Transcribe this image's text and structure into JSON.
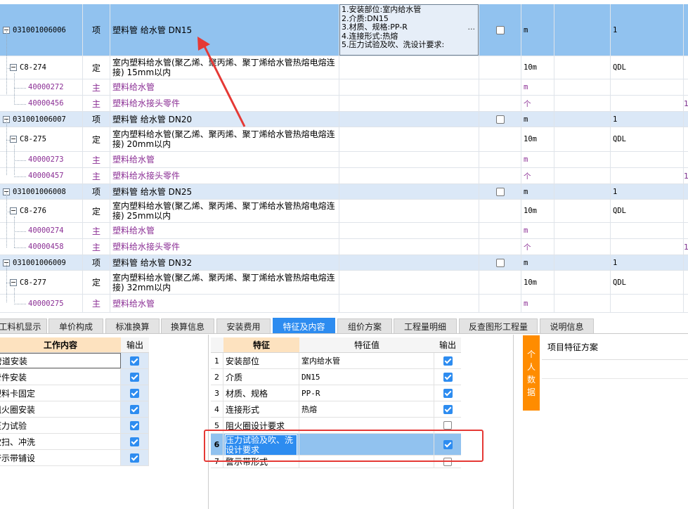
{
  "grid": {
    "rows": [
      {
        "code": "031001006006",
        "type": "项",
        "name": "塑料管 给水管 DN15",
        "unit": "m",
        "qty": "1",
        "selected": true,
        "kind": "item",
        "features": [
          "1.安装部位:室内给水管",
          "2.介质:DN15",
          "3.材质、规格:PP-R",
          "4.连接形式:热熔",
          "5.压力试验及吹、洗设计要求:"
        ]
      },
      {
        "code": "C8-274",
        "type": "定",
        "name": "室内塑料给水管(聚乙烯、聚丙烯、聚丁烯给水管热熔电熔连接) 15mm以内",
        "unit": "10m",
        "qty": "",
        "exp": "QDL",
        "kind": "ding"
      },
      {
        "code": "40000272",
        "type": "主",
        "name": "塑料给水管",
        "unit": "m",
        "kind": "zhu"
      },
      {
        "code": "40000456",
        "type": "主",
        "name": "塑料给水接头零件",
        "unit": "个",
        "kind": "zhu",
        "tail": "1"
      },
      {
        "code": "031001006007",
        "type": "项",
        "name": "塑料管  给水管 DN20",
        "unit": "m",
        "qty": "1",
        "kind": "item"
      },
      {
        "code": "C8-275",
        "type": "定",
        "name": "室内塑料给水管(聚乙烯、聚丙烯、聚丁烯给水管热熔电熔连接) 20mm以内",
        "unit": "10m",
        "exp": "QDL",
        "kind": "ding"
      },
      {
        "code": "40000273",
        "type": "主",
        "name": "塑料给水管",
        "unit": "m",
        "kind": "zhu"
      },
      {
        "code": "40000457",
        "type": "主",
        "name": "塑料给水接头零件",
        "unit": "个",
        "kind": "zhu",
        "tail": "1"
      },
      {
        "code": "031001006008",
        "type": "项",
        "name": "塑料管  给水管 DN25",
        "unit": "m",
        "qty": "1",
        "kind": "item"
      },
      {
        "code": "C8-276",
        "type": "定",
        "name": "室内塑料给水管(聚乙烯、聚丙烯、聚丁烯给水管热熔电熔连接) 25mm以内",
        "unit": "10m",
        "exp": "QDL",
        "kind": "ding"
      },
      {
        "code": "40000274",
        "type": "主",
        "name": "塑料给水管",
        "unit": "m",
        "kind": "zhu"
      },
      {
        "code": "40000458",
        "type": "主",
        "name": "塑料给水接头零件",
        "unit": "个",
        "kind": "zhu",
        "tail": "1"
      },
      {
        "code": "031001006009",
        "type": "项",
        "name": "塑料管  给水管 DN32",
        "unit": "m",
        "qty": "1",
        "kind": "item"
      },
      {
        "code": "C8-277",
        "type": "定",
        "name": "室内塑料给水管(聚乙烯、聚丙烯、聚丁烯给水管热熔电熔连接) 32mm以内",
        "unit": "10m",
        "exp": "QDL",
        "kind": "ding"
      },
      {
        "code": "40000275",
        "type": "主",
        "name": "塑料给水管",
        "unit": "m",
        "kind": "zhu"
      }
    ]
  },
  "tabs": [
    "工料机显示",
    "单价构成",
    "标准换算",
    "换算信息",
    "安装费用",
    "特征及内容",
    "组价方案",
    "工程量明细",
    "反查图形工程量",
    "说明信息"
  ],
  "active_tab": "特征及内容",
  "work": {
    "header": {
      "content": "工作内容",
      "output": "输出"
    },
    "rows": [
      {
        "label": "管道安装",
        "checked": true
      },
      {
        "label": "管件安装",
        "checked": true
      },
      {
        "label": "塑料卡固定",
        "checked": true
      },
      {
        "label": "阻火圈安装",
        "checked": true
      },
      {
        "label": "压力试验",
        "checked": true
      },
      {
        "label": "吹扫、冲洗",
        "checked": true
      },
      {
        "label": "警示带铺设",
        "checked": true
      }
    ]
  },
  "features": {
    "header": {
      "feature": "特征",
      "value": "特征值",
      "output": "输出"
    },
    "rows": [
      {
        "no": "1",
        "feature": "安装部位",
        "value": "室内给水管",
        "checked": true
      },
      {
        "no": "2",
        "feature": "介质",
        "value": "DN15",
        "checked": true
      },
      {
        "no": "3",
        "feature": "材质、规格",
        "value": "PP-R",
        "checked": true
      },
      {
        "no": "4",
        "feature": "连接形式",
        "value": "热熔",
        "checked": true
      },
      {
        "no": "5",
        "feature": "阻火圈设计要求",
        "value": "",
        "checked": false
      },
      {
        "no": "6",
        "feature": "压力试验及吹、洗设计要求",
        "value": "",
        "checked": true,
        "selected": true
      },
      {
        "no": "7",
        "feature": "警示带形式",
        "value": "",
        "checked": false
      }
    ]
  },
  "scheme": {
    "side_tab": "个人数据",
    "title": "项目特征方案"
  },
  "colors": {
    "accent": "#2d8cf0",
    "selected_row": "#91c2ef",
    "item_row": "#dbe8f7",
    "highlight": "#e53935",
    "side_tab": "#ff8c00"
  }
}
